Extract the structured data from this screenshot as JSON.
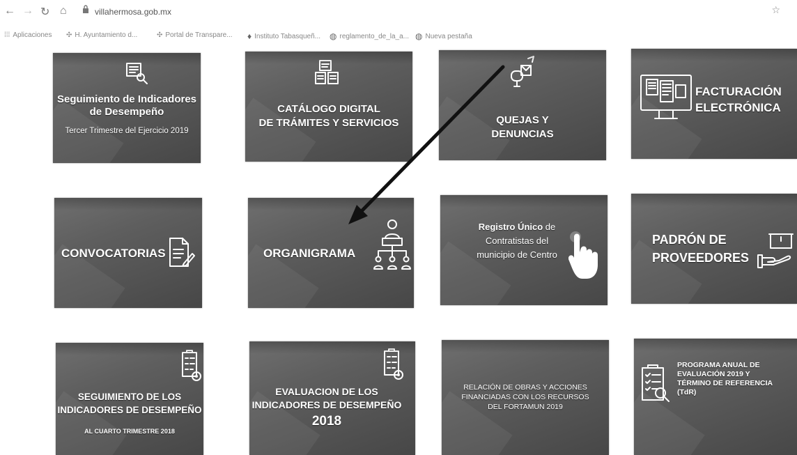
{
  "browser": {
    "url": "villahermosa.gob.mx",
    "bookmarks": [
      {
        "label": "Aplicaciones",
        "icon": "apps-icon"
      },
      {
        "label": "H. Ayuntamiento d...",
        "icon": "emblem-icon"
      },
      {
        "label": "Portal de Transpare...",
        "icon": "emblem-icon"
      },
      {
        "label": "Instituto Tabasqueñ...",
        "icon": "institute-icon"
      },
      {
        "label": "reglamento_de_la_a...",
        "icon": "globe-icon"
      },
      {
        "label": "Nueva pestaña",
        "icon": "globe-icon"
      }
    ]
  },
  "tiles": {
    "indicadores": {
      "title": "Seguimiento de Indicadores de Desempeño",
      "subtitle": "Tercer Trimestre del Ejercicio 2019"
    },
    "catalogo": {
      "line1": "CATÁLOGO DIGITAL",
      "line2": "DE TRÁMITES Y SERVICIOS"
    },
    "quejas": {
      "line1": "QUEJAS Y",
      "line2": "DENUNCIAS"
    },
    "facturacion": {
      "line1": "FACTURACIÓN",
      "line2": "ELECTRÓNICA"
    },
    "convocatorias": {
      "label": "CONVOCATORIAS"
    },
    "organigrama": {
      "label": "ORGANIGRAMA"
    },
    "registro": {
      "bold": "Registro Único",
      "rest1": " de",
      "line2": "Contratistas del",
      "line3": "municipio de Centro"
    },
    "padron": {
      "line1": "PADRÓN DE",
      "line2": "PROVEEDORES"
    },
    "seguimiento2018": {
      "line1": "SEGUIMIENTO DE LOS",
      "line2": "INDICADORES DE DESEMPEÑO",
      "line3": "AL CUARTO TRIMESTRE 2018"
    },
    "evaluacion": {
      "line1": "EVALUACION DE LOS",
      "line2": "INDICADORES DE DESEMPEÑO",
      "line3": "2018"
    },
    "obras": {
      "line1": "RELACIÓN DE OBRAS Y ACCIONES",
      "line2": "FINANCIADAS CON LOS RECURSOS",
      "line3": "DEL FORTAMUN 2019"
    },
    "programa": {
      "line1": "PROGRAMA ANUAL DE",
      "line2": "EVALUACIÓN 2019 Y",
      "line3": "TÉRMINO DE REFERENCIA",
      "line4": "(TdR)"
    }
  }
}
